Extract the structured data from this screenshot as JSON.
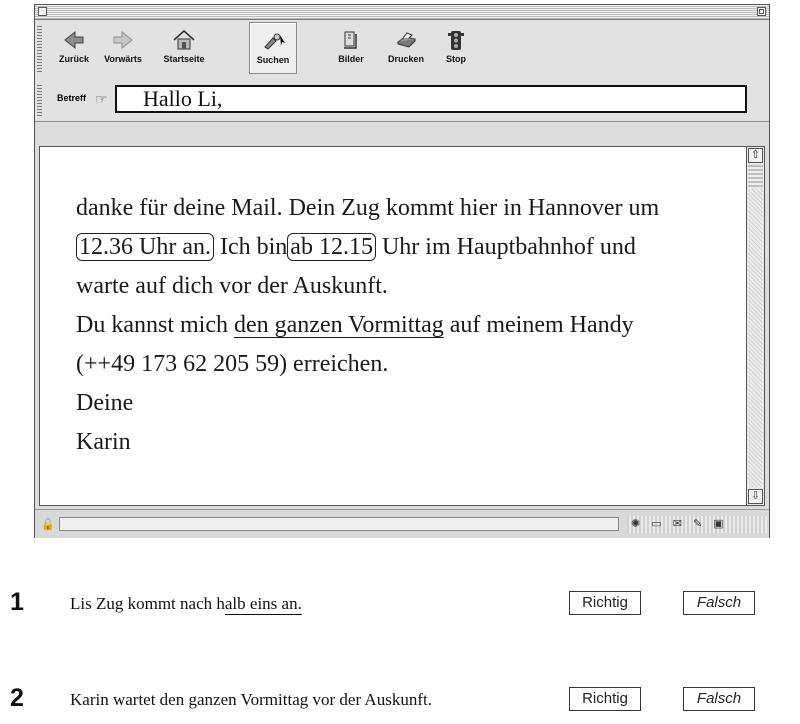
{
  "toolbar": {
    "buttons": [
      {
        "label": "Zurück",
        "icon": "back-arrow-icon"
      },
      {
        "label": "Vorwärts",
        "icon": "forward-arrow-icon"
      },
      {
        "label": "Startseite",
        "icon": "home-icon"
      },
      {
        "label": "Suchen",
        "icon": "search-icon"
      },
      {
        "label": "Bilder",
        "icon": "images-icon"
      },
      {
        "label": "Drucken",
        "icon": "print-icon"
      },
      {
        "label": "Stop",
        "icon": "stop-icon"
      }
    ]
  },
  "subject": {
    "label": "Betreff",
    "value": "Hallo Li,"
  },
  "message": {
    "l1": "danke für deine Mail. Dein Zug kommt hier in Hannover um",
    "l2_box1": "12.36 Uhr an.",
    "l2_mid": " Ich bin",
    "l2_box2": "ab 12.15",
    "l2_end": " Uhr im Hauptbahnhof und",
    "l3": "warte auf dich vor der Auskunft.",
    "l4_start": "Du kannst mich ",
    "l4_underlined": "den ganzen Vormittag",
    "l4_end": " auf meinem Handy",
    "l5": "(++49 173 62 205 59) erreichen.",
    "l6": "Deine",
    "l7": "Karin"
  },
  "items": [
    {
      "number": "1",
      "text_start": "Lis Zug kommt nach h",
      "text_underlined": "alb eins an.",
      "text_end": "",
      "richtig": "Richtig",
      "falsch": "Falsch"
    },
    {
      "number": "2",
      "text_start": "Karin wartet den ganzen Vormittag vor der Auskunft.",
      "text_underlined": "",
      "text_end": "",
      "richtig": "Richtig",
      "falsch": "Falsch"
    }
  ]
}
